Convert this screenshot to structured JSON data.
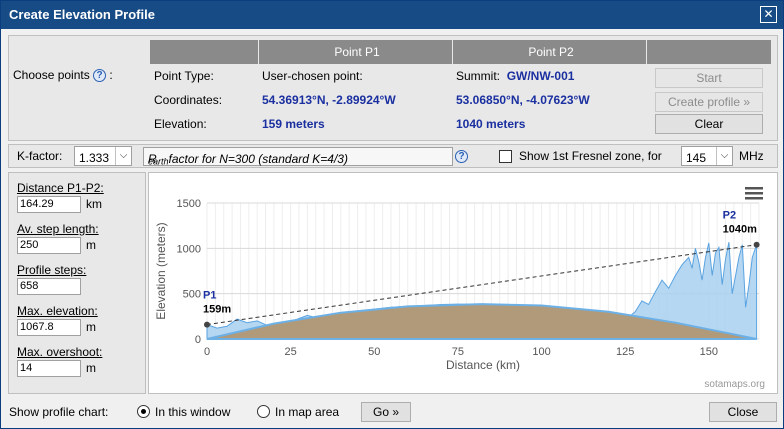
{
  "window": {
    "title": "Create Elevation Profile",
    "close_glyph": "✕"
  },
  "choose": {
    "label": "Choose points",
    "colon": ":",
    "help": "?"
  },
  "points": {
    "header": {
      "p1": "Point P1",
      "p2": "Point P2"
    },
    "rows": [
      {
        "label": "Point Type:",
        "p1": "User-chosen point:",
        "p2_prefix": "Summit:",
        "p2": "GW/NW-001"
      },
      {
        "label": "Coordinates:",
        "p1": "54.36913°N, -2.89924°W",
        "p2": "53.06850°N, -4.07623°W"
      },
      {
        "label": "Elevation:",
        "p1": "159 meters",
        "p2": "1040 meters"
      }
    ],
    "buttons": {
      "start": "Start",
      "create": "Create profile »",
      "clear": "Clear"
    }
  },
  "kfactor": {
    "label": "K-factor:",
    "value": "1.333",
    "rearth_prefix": "R",
    "rearth_sub": "earth",
    "rearth_text": " factor for N=300 (standard K=4/3)",
    "help": "?",
    "fresnel_label": "Show 1st Fresnel zone, for",
    "fresnel_value": "145",
    "fresnel_unit": "MHz"
  },
  "stats": {
    "distance": {
      "label": "Distance P1-P2:",
      "value": "164.29",
      "unit": "km"
    },
    "step": {
      "label": "Av. step length:",
      "value": "250",
      "unit": "m"
    },
    "steps": {
      "label": "Profile steps:",
      "value": "658"
    },
    "max_elev": {
      "label": "Max. elevation:",
      "value": "1067.8",
      "unit": "m"
    },
    "overshoot": {
      "label": "Max. overshoot:",
      "value": "14",
      "unit": "m"
    }
  },
  "bottom": {
    "label": "Show profile chart:",
    "opt1": "In this window",
    "opt2": "In map area",
    "go": "Go »",
    "close": "Close"
  },
  "chart_data": {
    "type": "area",
    "xlabel": "Distance (km)",
    "ylabel": "Elevation (meters)",
    "xlim": [
      0,
      165
    ],
    "ylim": [
      0,
      1500
    ],
    "xticks": [
      0,
      25,
      50,
      75,
      100,
      125,
      150
    ],
    "yticks": [
      0,
      500,
      1000,
      1500
    ],
    "grid": true,
    "credit": "sotamaps.org",
    "menu_icon": "hamburger-menu-icon",
    "colors": {
      "terrain": "#a8d0f0",
      "terrain_stroke": "#5aa3e0",
      "earth": "#b09a7a",
      "earth_stroke": "#6cb0e6",
      "los": "#333333",
      "p_label": "#1a2fa0"
    },
    "p1": {
      "label": "P1",
      "elevation_label": "159m",
      "x": 0,
      "y": 159
    },
    "p2": {
      "label": "P2",
      "elevation_label": "1040m",
      "x": 164.29,
      "y": 1040
    },
    "earth_bulge": {
      "x": [
        0,
        20,
        40,
        60,
        82,
        100,
        120,
        140,
        155,
        164.29
      ],
      "y": [
        0,
        170,
        290,
        360,
        385,
        370,
        300,
        180,
        70,
        0
      ]
    },
    "terrain": {
      "x": [
        0,
        3,
        6,
        9,
        12,
        15,
        18,
        21,
        24,
        27,
        30,
        33,
        36,
        40,
        45,
        50,
        55,
        60,
        65,
        70,
        75,
        80,
        85,
        90,
        95,
        100,
        105,
        110,
        115,
        120,
        125,
        128,
        130,
        132,
        134,
        136,
        138,
        140,
        142,
        144,
        145,
        146,
        147,
        148,
        149,
        150,
        151,
        152,
        153,
        154,
        155,
        156,
        157,
        158,
        159,
        160,
        161,
        162,
        163,
        164.29
      ],
      "y": [
        159,
        120,
        140,
        220,
        180,
        200,
        150,
        130,
        170,
        220,
        260,
        230,
        250,
        290,
        310,
        330,
        350,
        360,
        370,
        380,
        385,
        380,
        375,
        370,
        360,
        350,
        330,
        310,
        280,
        250,
        210,
        300,
        420,
        380,
        520,
        650,
        560,
        700,
        820,
        900,
        780,
        1000,
        850,
        650,
        900,
        1060,
        700,
        950,
        1010,
        600,
        880,
        1067.8,
        500,
        700,
        900,
        1040,
        350,
        600,
        900,
        1040
      ]
    }
  }
}
